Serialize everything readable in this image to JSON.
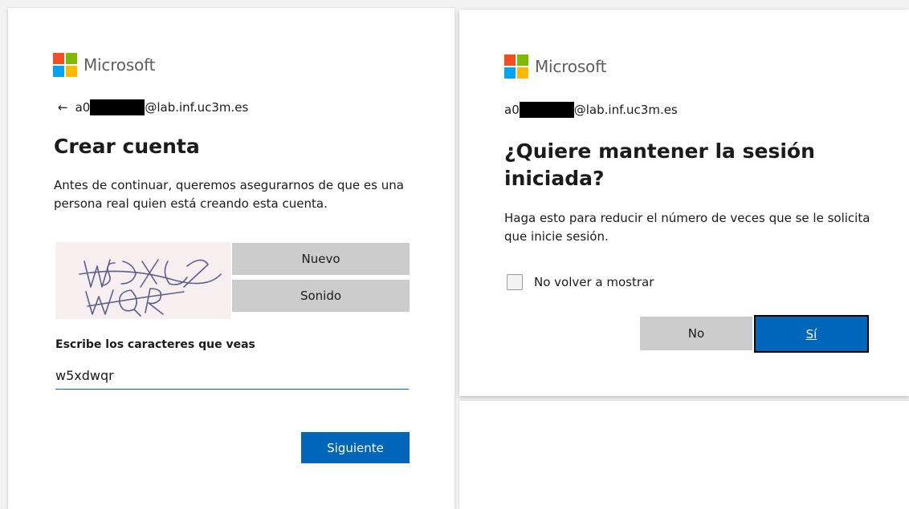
{
  "colors": {
    "ms_red": "#f25022",
    "ms_green": "#7fba00",
    "ms_blue": "#00a4ef",
    "ms_yellow": "#ffb900",
    "primary_button": "#0067b8",
    "secondary_button": "#cccccc"
  },
  "left_panel": {
    "logo_text": "Microsoft",
    "back_icon": "back-arrow-icon",
    "identity": {
      "prefix": "a0",
      "suffix": "@lab.inf.uc3m.es"
    },
    "title": "Crear cuenta",
    "description": "Antes de continuar, queremos asegurarnos de que es una persona real quien está creando esta cuenta.",
    "captcha": {
      "new_button": "Nuevo",
      "audio_button": "Sonido"
    },
    "input_label": "Escribe los caracteres que veas",
    "input_value": "w5xdwqr",
    "next_button": "Siguiente"
  },
  "right_panel": {
    "logo_text": "Microsoft",
    "identity": {
      "prefix": "a0",
      "suffix": "@lab.inf.uc3m.es"
    },
    "title": "¿Quiere mantener la sesión iniciada?",
    "description": "Haga esto para reducir el número de veces que se le solicita que inicie sesión.",
    "checkbox_label": "No volver a mostrar",
    "no_button": "No",
    "yes_button": "Sí"
  }
}
